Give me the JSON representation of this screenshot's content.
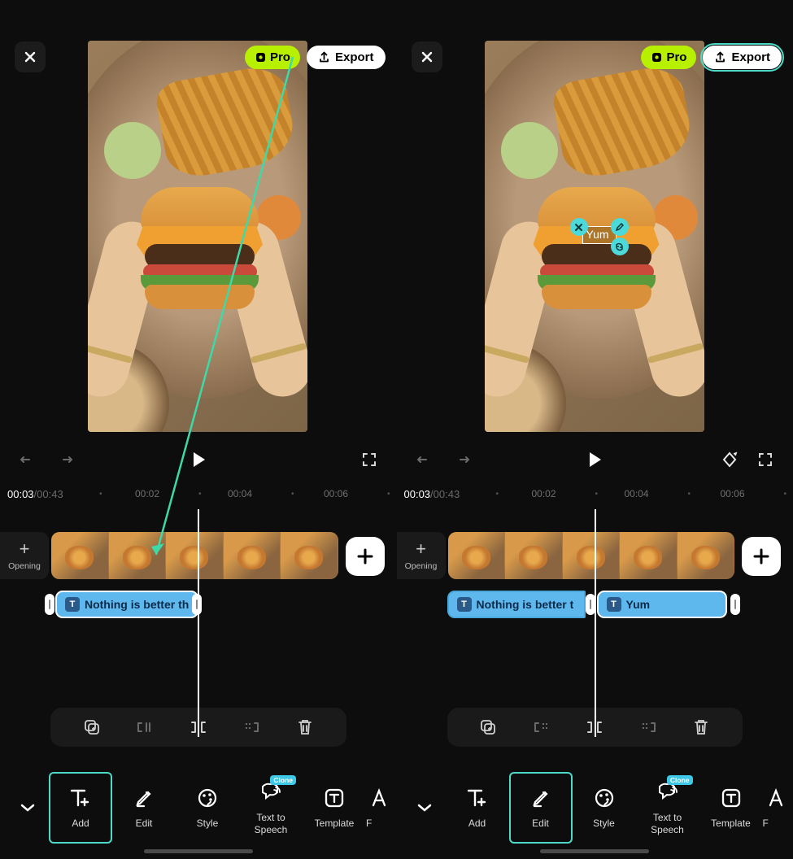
{
  "left": {
    "pro_label": "Pro",
    "export_label": "Export",
    "time_current": "00:03",
    "time_total": "/00:43",
    "ruler_labels": [
      "00:02",
      "00:04",
      "00:06"
    ],
    "opening_label": "Opening",
    "text_clip_1": "Nothing is better th",
    "tools": {
      "add": "Add",
      "edit": "Edit",
      "style": "Style",
      "tts": "Text to Speech",
      "template": "Template",
      "clone_badge": "Clone",
      "partial": "F"
    }
  },
  "right": {
    "pro_label": "Pro",
    "export_label": "Export",
    "time_current": "00:03",
    "time_total": "/00:43",
    "ruler_labels": [
      "00:02",
      "00:04",
      "00:06"
    ],
    "opening_label": "Opening",
    "text_clip_1": "Nothing is better t",
    "text_clip_2": "Yum",
    "overlay_text": "Yum",
    "tools": {
      "add": "Add",
      "edit": "Edit",
      "style": "Style",
      "tts": "Text to Speech",
      "template": "Template",
      "clone_badge": "Clone",
      "partial": "F"
    }
  }
}
